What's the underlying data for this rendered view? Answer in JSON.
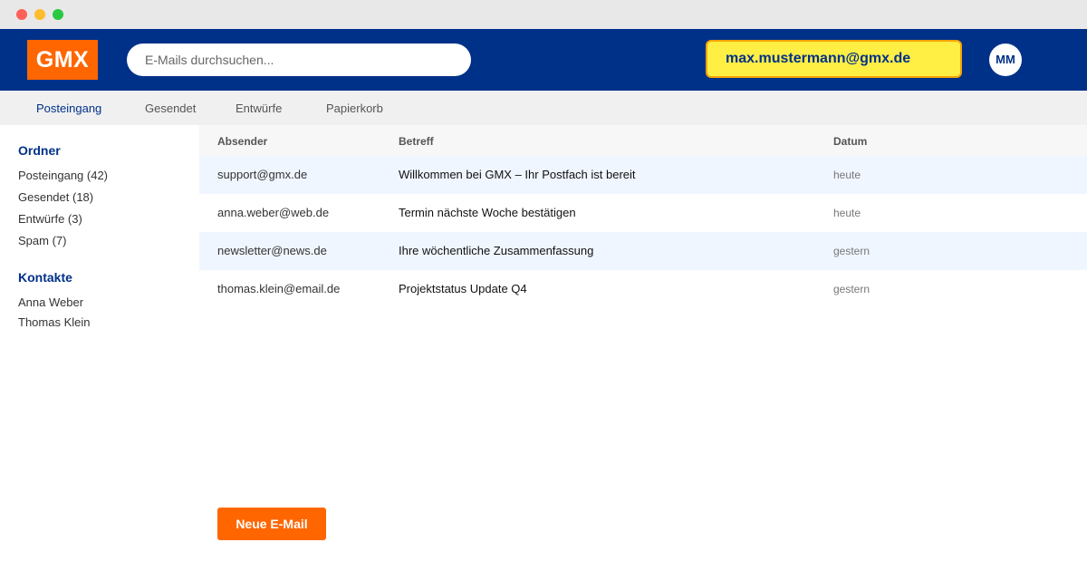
{
  "window": {
    "controls": [
      "close",
      "minimize",
      "maximize"
    ]
  },
  "header": {
    "logo": "GMX",
    "search_placeholder": "E-Mails durchsuchen...",
    "account_email": "max.mustermann@gmx.de",
    "avatar_initials": "MM"
  },
  "tabs": [
    {
      "label": "Posteingang",
      "active": true
    },
    {
      "label": "Gesendet",
      "active": false
    },
    {
      "label": "Entwürfe",
      "active": false
    },
    {
      "label": "Papierkorb",
      "active": false
    }
  ],
  "sidebar": {
    "folders_heading": "Ordner",
    "folders": [
      {
        "label": "Posteingang (42)"
      },
      {
        "label": "Gesendet (18)"
      },
      {
        "label": "Entwürfe (3)"
      },
      {
        "label": "Spam (7)"
      }
    ],
    "contacts_heading": "Kontakte",
    "contacts": [
      {
        "label": "Anna Weber"
      },
      {
        "label": "Thomas Klein"
      }
    ]
  },
  "mail_list": {
    "columns": [
      "Absender",
      "Betreff",
      "Datum"
    ],
    "rows": [
      {
        "sender": "support@gmx.de",
        "subject": "Willkommen bei GMX – Ihr Postfach ist bereit",
        "date": "heute"
      },
      {
        "sender": "anna.weber@web.de",
        "subject": "Termin nächste Woche bestätigen",
        "date": "heute"
      },
      {
        "sender": "newsletter@news.de",
        "subject": "Ihre wöchentliche Zusammenfassung",
        "date": "gestern"
      },
      {
        "sender": "thomas.klein@email.de",
        "subject": "Projektstatus Update Q4",
        "date": "gestern"
      }
    ]
  },
  "compose_label": "Neue E-Mail",
  "colors": {
    "header_bg": "#003189",
    "brand_orange": "#ff6600",
    "account_highlight": "#ffee44",
    "row_highlight": "#f0f6ff"
  }
}
